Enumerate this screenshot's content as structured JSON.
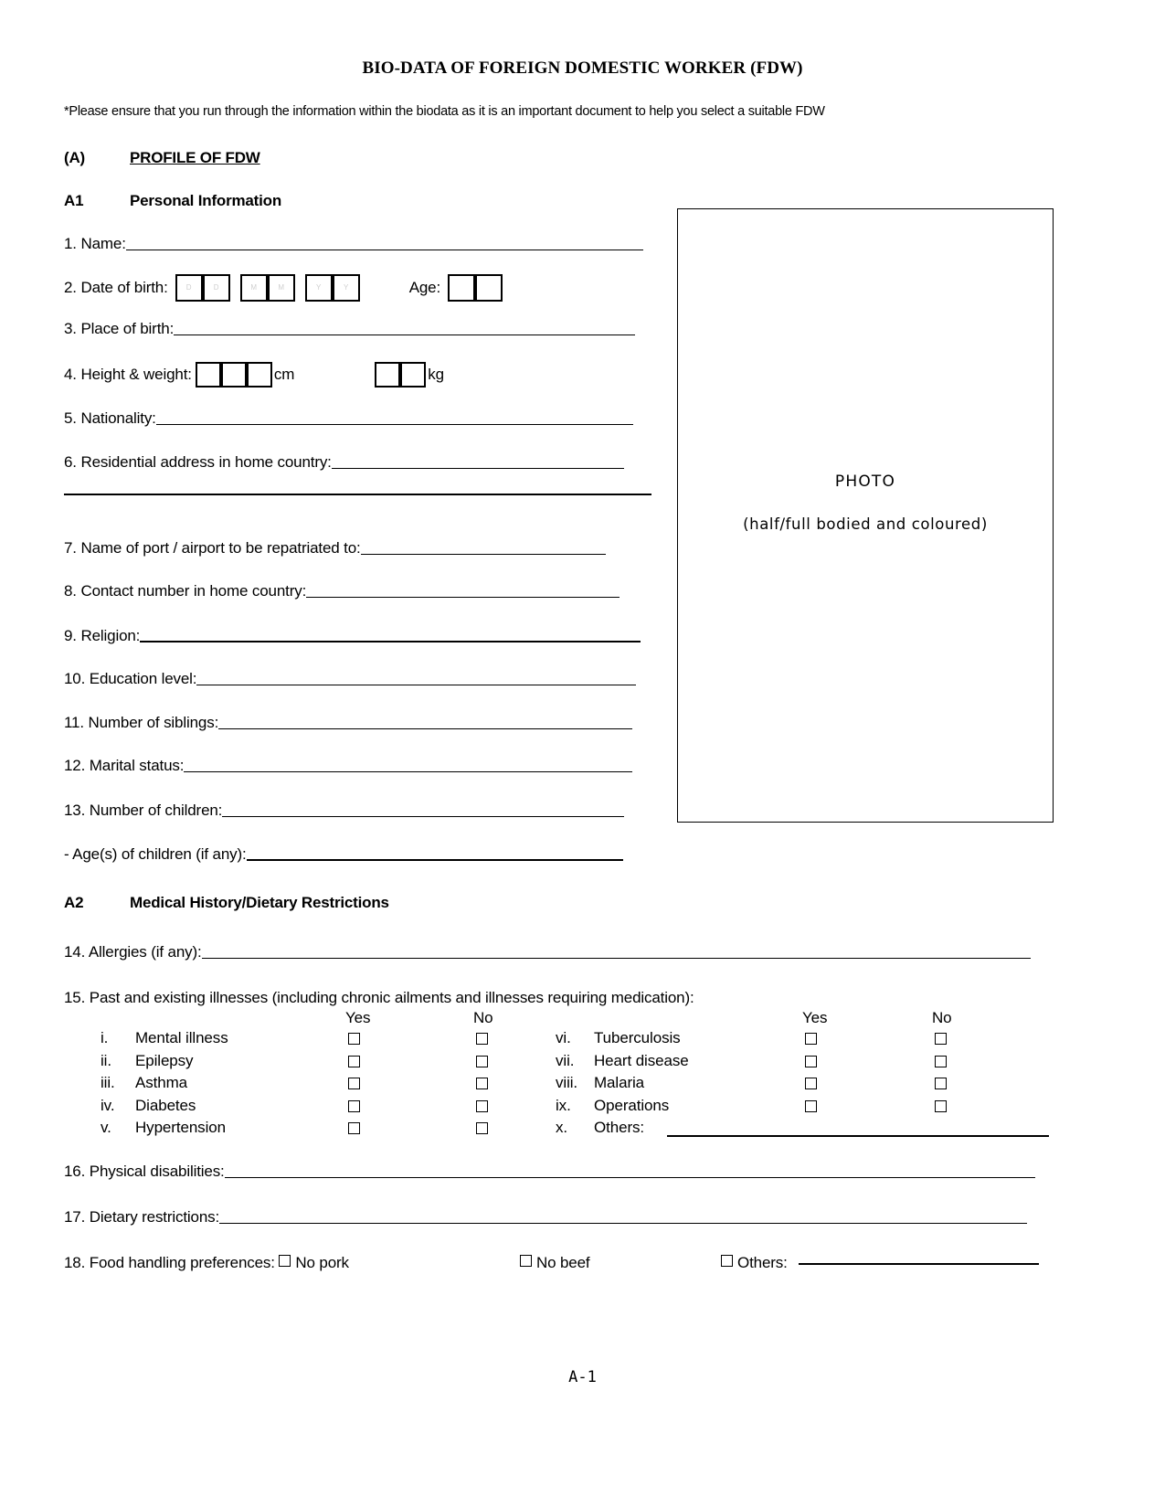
{
  "document": {
    "title": "BIO-DATA OF FOREIGN DOMESTIC WORKER (FDW)",
    "note": "*Please ensure that you run through the information within the biodata as it is an important document to help you select a suitable FDW",
    "footer": "A-1"
  },
  "section_a": {
    "tag": "(A)",
    "title": "PROFILE OF FDW"
  },
  "section_a1": {
    "tag": "A1",
    "title": "Personal Information",
    "fields": {
      "name": "1. Name:",
      "dob": "2. Date of birth:",
      "age": "Age:",
      "place_of_birth": "3. Place of birth:",
      "height_weight": "4. Height & weight:",
      "unit_cm": "cm",
      "unit_kg": "kg",
      "nationality": "5. Nationality:",
      "residential_address": "6. Residential address in home country:",
      "port_airport": "7. Name of port / airport to be repatriated to:",
      "contact_number": "8. Contact number in home country:",
      "religion": "9. Religion:",
      "education_level": "10. Education level:",
      "number_of_siblings": "11. Number of siblings:",
      "marital_status": "12. Marital status:",
      "number_of_children": "13. Number of children:",
      "ages_of_children": "- Age(s) of children (if any):"
    },
    "dob_hints": [
      "D",
      "D",
      "M",
      "M",
      "Y",
      "Y"
    ]
  },
  "photo_box": {
    "label": "PHOTO",
    "sublabel": "(half/full bodied and coloured)"
  },
  "section_a2": {
    "tag": "A2",
    "title": "Medical History/Dietary Restrictions",
    "allergies": "14. Allergies (if any):",
    "illness_question": "15. Past and existing illnesses (including chronic ailments and illnesses requiring medication):",
    "column_headers": {
      "yes": "Yes",
      "no": "No"
    },
    "illnesses_left": [
      {
        "num": "i.",
        "label": "Mental illness"
      },
      {
        "num": "ii.",
        "label": "Epilepsy"
      },
      {
        "num": "iii.",
        "label": "Asthma"
      },
      {
        "num": "iv.",
        "label": "Diabetes"
      },
      {
        "num": "v.",
        "label": "Hypertension"
      }
    ],
    "illnesses_right": [
      {
        "num": "vi.",
        "label": "Tuberculosis"
      },
      {
        "num": "vii.",
        "label": "Heart disease"
      },
      {
        "num": "viii.",
        "label": "Malaria"
      },
      {
        "num": "ix.",
        "label": "Operations"
      },
      {
        "num": "x.",
        "label": "Others:"
      }
    ],
    "physical_disabilities": "16. Physical disabilities:",
    "dietary_restrictions": "17. Dietary restrictions:",
    "food_handling": {
      "label": "18. Food handling preferences:",
      "option_no_pork": "No pork",
      "option_no_beef": "No beef",
      "option_others": "Others:"
    }
  }
}
